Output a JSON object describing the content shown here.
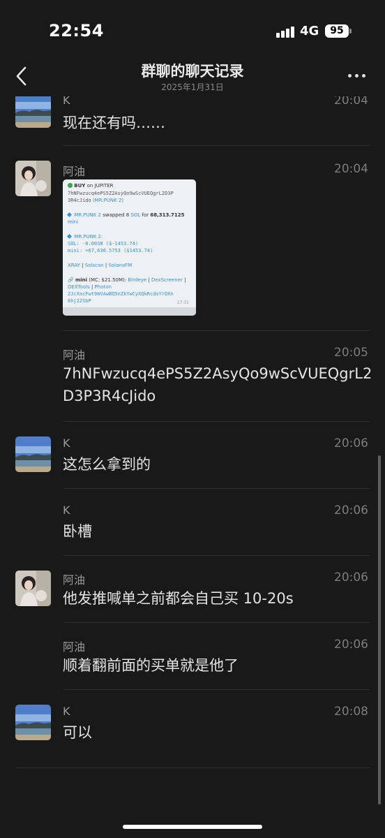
{
  "status": {
    "time": "22:54",
    "network": "4G",
    "battery": "95"
  },
  "nav": {
    "title": "群聊的聊天记录",
    "subtitle": "2025年1月31日"
  },
  "messages": [
    {
      "sender": "K",
      "time": "20:04",
      "text": "现在还有吗……",
      "avatar": "landscape"
    },
    {
      "sender": "阿油",
      "time": "20:04",
      "avatar": "girl",
      "card": {
        "l1_buy": "BUY",
        "l1_on": "on JUPITER",
        "l2": "7hNFwzucq4ePS5Z2AsyQo9wScVUEQgrL2D3P",
        "l3": "3R4cJido",
        "l3_tag": "(MR.PUNK 2)",
        "l4_who": "MR.PUNK 2",
        "l4_mid": "swapped 8",
        "l4_sol": "SOL",
        "l4_for": "for",
        "l4_amt": "68,313.7125",
        "l5": "mini",
        "l6": "MR.PUNK 2:",
        "l7": "SOL: -8.0038 ($-1453.74)",
        "l8": "mini: +67,630.5753 ($1453.74)",
        "l9_a": "XRAY",
        "l9_b": "Solscan",
        "l9_c": "SolanaFM",
        "l10_a": "mini",
        "l10_b": "(MC: $21.50M):",
        "l10_c": "Birdeye",
        "l10_d": "DexScreener",
        "l11_a": "DEXTools",
        "l11_b": "Photon",
        "l12": "2JcXacFwt9mVAwBQ5nZkYwCyXQkRcdsYrDXn",
        "l13": "6hj22SbP",
        "stamp": "17:31"
      }
    },
    {
      "sender": "阿油",
      "time": "20:05",
      "text": "7hNFwzucq4ePS5Z2AsyQo9wScVUEQgrL2D3P3R4cJido"
    },
    {
      "sender": "K",
      "time": "20:06",
      "text": "这怎么拿到的",
      "avatar": "landscape"
    },
    {
      "sender": "K",
      "time": "20:06",
      "text": "卧槽"
    },
    {
      "sender": "阿油",
      "time": "20:06",
      "text": "他发推喊单之前都会自己买 10-20s",
      "avatar": "girl"
    },
    {
      "sender": "阿油",
      "time": "20:06",
      "text": "顺着翻前面的买单就是他了"
    },
    {
      "sender": "K",
      "time": "20:08",
      "text": "可以",
      "avatar": "landscape"
    }
  ],
  "colors": {
    "background": "#191919",
    "link": "#3a8fd6",
    "card": "#eef1f4"
  }
}
